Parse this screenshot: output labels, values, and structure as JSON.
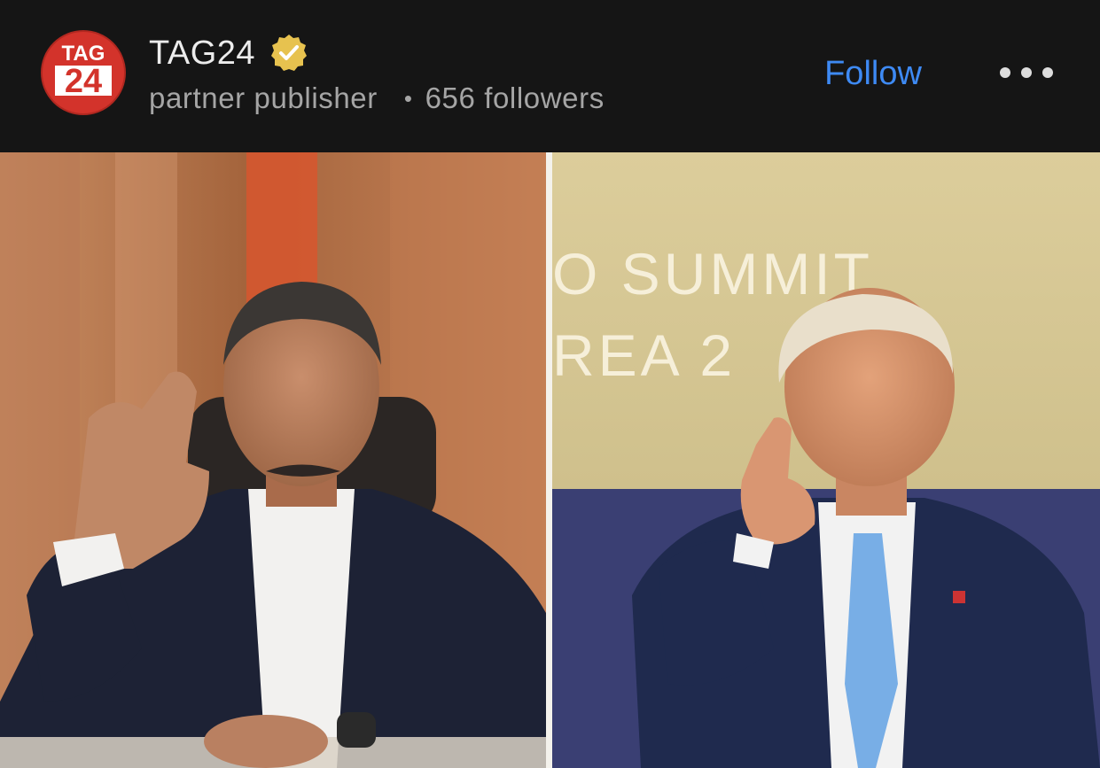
{
  "publisher": {
    "logo_text_top": "TAG",
    "logo_text_bottom": "24",
    "name": "TAG24",
    "subtitle": "partner publisher",
    "separator": "•",
    "followers": "656 followers"
  },
  "actions": {
    "follow_label": "Follow"
  },
  "media": {
    "right_backdrop_line1": "O SUMMIT",
    "right_backdrop_line2": "REA 2"
  },
  "colors": {
    "background": "#151515",
    "accent_blue": "#3e8af4",
    "verified_gold": "#e7c24f",
    "logo_red": "#d3332b"
  },
  "icons": {
    "verified": "verified-badge-icon",
    "more": "ellipsis-icon"
  }
}
